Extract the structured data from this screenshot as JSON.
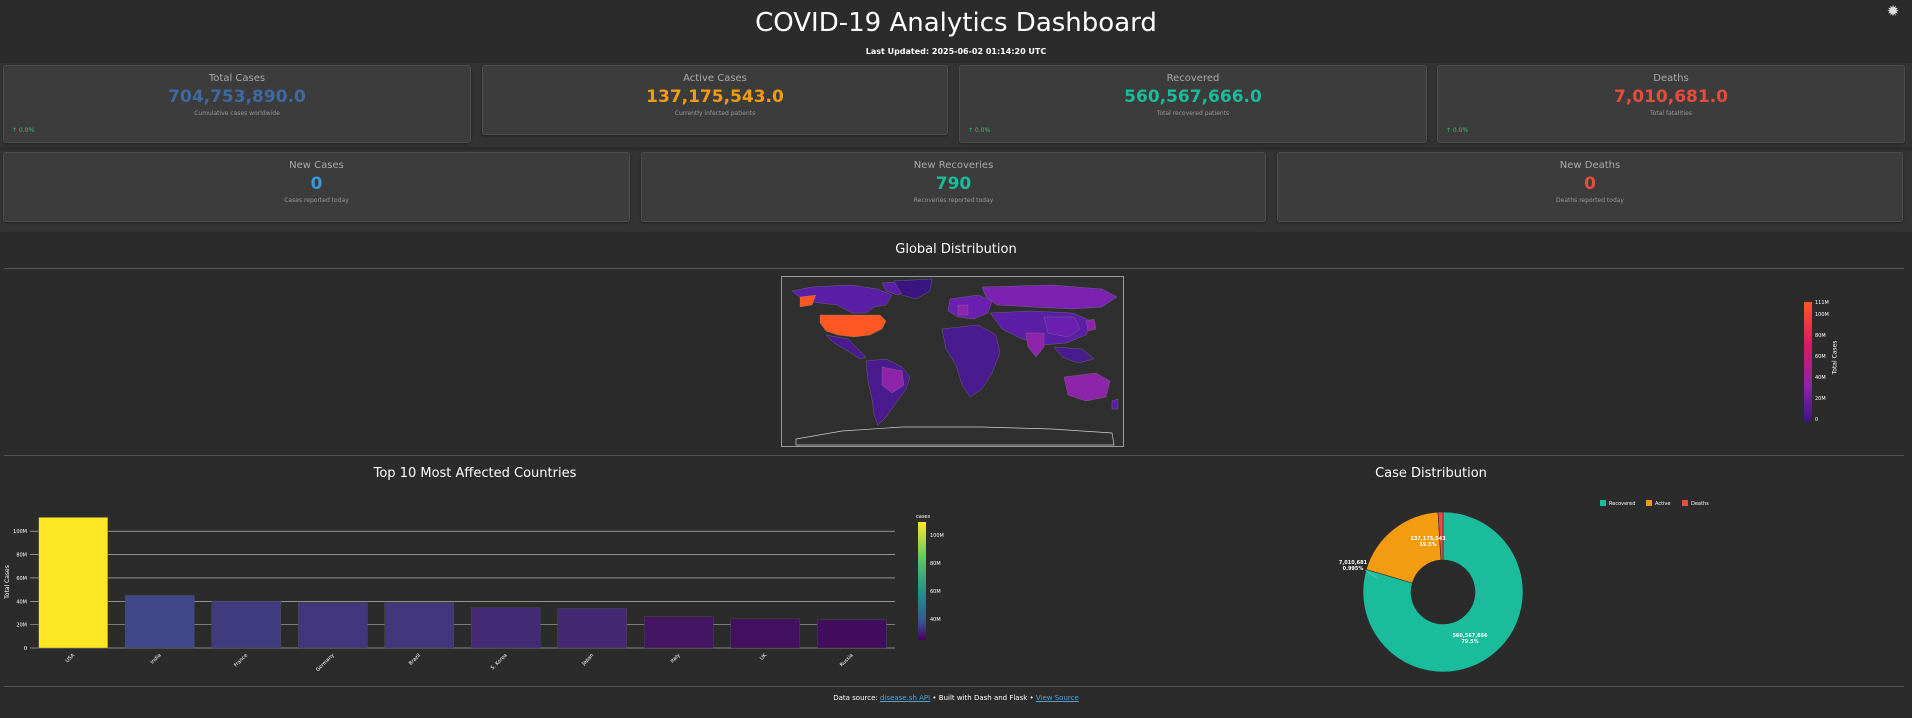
{
  "header": {
    "title": "COVID-19 Analytics Dashboard",
    "last_updated": "Last Updated: 2025-06-02 01:14:20 UTC",
    "settings_icon": "gear-icon"
  },
  "stats_top": [
    {
      "label": "Total Cases",
      "value": "704,753,890.0",
      "sub": "Cumulative cases worldwide",
      "change": "↑ 0.0%",
      "color": "#3d6aa0"
    },
    {
      "label": "Active Cases",
      "value": "137,175,543.0",
      "sub": "Currently infected patients",
      "change": "",
      "color": "#f39c12"
    },
    {
      "label": "Recovered",
      "value": "560,567,666.0",
      "sub": "Total recovered patients",
      "change": "↑ 0.0%",
      "color": "#1abc9c"
    },
    {
      "label": "Deaths",
      "value": "7,010,681.0",
      "sub": "Total fatalities",
      "change": "↑ 0.0%",
      "color": "#e74c3c"
    }
  ],
  "stats_bottom": [
    {
      "label": "New Cases",
      "value": "0",
      "sub": "Cases reported today",
      "color": "#3498db"
    },
    {
      "label": "New Recoveries",
      "value": "790",
      "sub": "Recoveries reported today",
      "color": "#1abc9c"
    },
    {
      "label": "New Deaths",
      "value": "0",
      "sub": "Deaths reported today",
      "color": "#e74c3c"
    }
  ],
  "map": {
    "title": "Global Distribution",
    "colorbar_title": "Total Cases",
    "colorbar_ticks": [
      "111M",
      "100M",
      "80M",
      "60M",
      "40M",
      "20M",
      "0"
    ]
  },
  "chart_data": [
    {
      "type": "bar",
      "title": "Top 10 Most Affected Countries",
      "xlabel": "",
      "ylabel": "Total Cases",
      "categories": [
        "USA",
        "India",
        "France",
        "Germany",
        "Brazil",
        "S. Korea",
        "Japan",
        "Italy",
        "UK",
        "Russia"
      ],
      "values": [
        111800000,
        45000000,
        40100000,
        38800000,
        38700000,
        34600000,
        33800000,
        26800000,
        24900000,
        24100000
      ],
      "ylim": [
        0,
        113000000
      ],
      "y_ticks": [
        0,
        20000000,
        40000000,
        60000000,
        80000000,
        100000000
      ],
      "y_tick_labels": [
        "0",
        "20M",
        "40M",
        "60M",
        "80M",
        "100M"
      ],
      "colorbar_title": "cases",
      "colorbar_ticks": [
        "100M",
        "80M",
        "60M",
        "40M"
      ],
      "grid": true
    },
    {
      "type": "pie",
      "title": "Case Distribution",
      "labels": [
        "Recovered",
        "Active",
        "Deaths"
      ],
      "values": [
        560567666,
        137175543,
        7010681
      ],
      "colors": [
        "#1abc9c",
        "#f39c12",
        "#e74c3c"
      ],
      "data_labels": [
        [
          "560,567,666",
          "79.5%"
        ],
        [
          "137,175,543",
          "19.5%"
        ],
        [
          "7,010,681",
          "0.995%"
        ]
      ],
      "hole": 0.4,
      "legend_position": "top-right"
    }
  ],
  "footer": {
    "prefix": "Data source: ",
    "source_link": "disease.sh API",
    "middle": " • Built with Dash and Flask • ",
    "view_source": "View Source"
  }
}
